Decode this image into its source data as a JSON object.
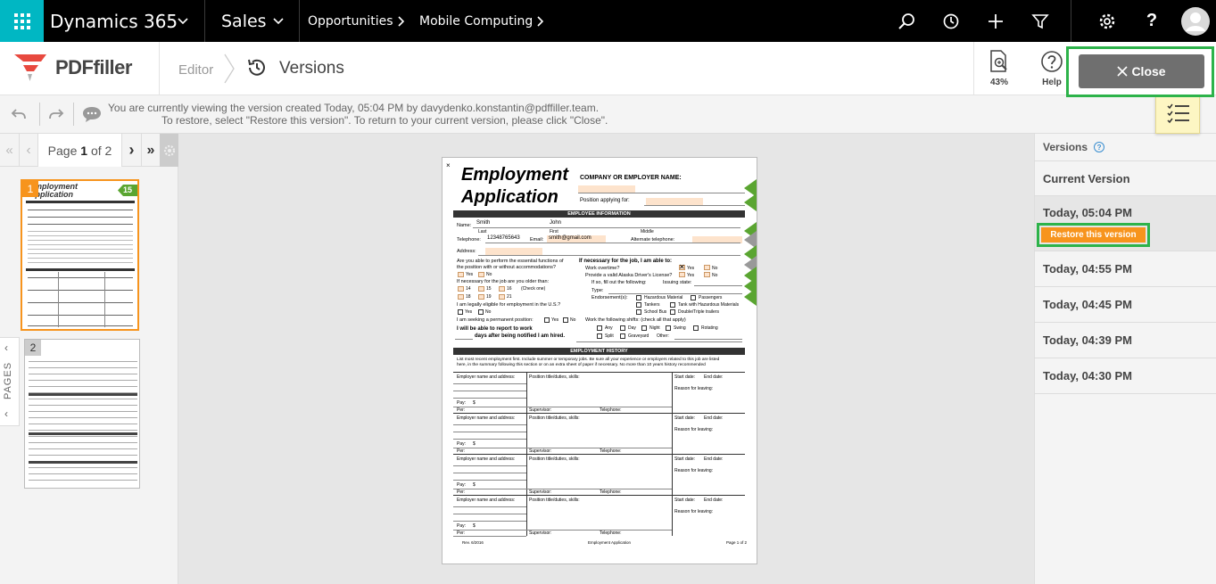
{
  "topbar": {
    "app_name": "Dynamics 365",
    "module": "Sales",
    "breadcrumb": [
      "Opportunities",
      "Mobile Computing"
    ]
  },
  "pdfbar": {
    "logo_text": "PDFfiller",
    "editor_label": "Editor",
    "versions_title": "Versions",
    "zoom": "43%",
    "help_label": "Help",
    "close_label": "Close"
  },
  "message": {
    "line1": "You are currently viewing the version created Today, 05:04 PM by davydenko.konstantin@pdffiller.team.",
    "line2": "To restore, select \"Restore this version\". To return to your current version, please click \"Close\"."
  },
  "pager": {
    "prefix": "Page",
    "current": "1",
    "of": "of 2"
  },
  "thumbnails": [
    {
      "number": "1",
      "badge": "15"
    },
    {
      "number": "2"
    }
  ],
  "pages_tab": "PAGES",
  "versions_panel": {
    "title": "Versions",
    "current": "Current Version",
    "selected": "Today, 05:04 PM",
    "restore_label": "Restore this version",
    "items": [
      "Today, 04:55 PM",
      "Today, 04:45 PM",
      "Today, 04:39 PM",
      "Today, 04:30 PM"
    ]
  },
  "doc": {
    "title1": "Employment",
    "title2": "Application",
    "company_label": "COMPANY OR EMPLOYER NAME:",
    "position_label": "Position applying for:",
    "sec_info": "EMPLOYEE INFORMATION",
    "name_label": "Name:",
    "last_name": "Smith",
    "first_name": "John",
    "last_label": "Last",
    "first_label": "First",
    "middle_label": "Middle",
    "telephone_label": "Telephone:",
    "telephone": "12348765643",
    "email_label": "Email:",
    "email": "smith@gmail.com",
    "alt_phone_label": "Alternate telephone:",
    "address_label": "Address:",
    "q_able1": "Are you able to perform the essential functions of",
    "q_able2": "the position with or without accommodations?",
    "yes": "Yes",
    "no": "No",
    "q_age": "If necessary for the job are you older than:",
    "ages": [
      "14",
      "15",
      "16",
      "18",
      "19",
      "21"
    ],
    "check_one": "(Check one)",
    "q_legal": "I am legally eligible for employment in the U.S.?",
    "q_perm": "I am seeking a permanent position:",
    "report1": "I will be able to report to work",
    "report2": "days after being notified I am hired.",
    "if_nec": "If necessary for the job, I am able to:",
    "work_ot": "Work overtime?",
    "drivers": "Provide a valid Alaska Driver's License?",
    "if_so": "If so, fill out the following:",
    "issuing": "Issuing state:",
    "type": "Type:",
    "endorse": "Endorsement(s):",
    "endorse_items": [
      "Hazardous Material",
      "Passengers",
      "Tankers",
      "Tank with Hazardous Materials",
      "School Bus",
      "Double/Triple trailers"
    ],
    "shifts_q": "Work the following shifts: (check all that apply)",
    "shifts": [
      "Any",
      "Day",
      "Night",
      "Swing",
      "Rotating",
      "Split",
      "Graveyard",
      "Other:"
    ],
    "sec_history": "EMPLOYMENT HISTORY",
    "history_text1": "List most recent employment first. Include summer or temporary jobs. Be sure all your experience or employers related to this job are listed",
    "history_text2": "here, in the summary following this section or on an extra sheet of paper if necessary. No more than 10 years history recommended",
    "emp_label": "Employer name and address:",
    "pos_label": "Position title/duties, skills:",
    "start_label": "Start date:",
    "end_label": "End date:",
    "reason_label": "Reason for leaving:",
    "pay_label": "Pay:",
    "dollar": "$",
    "per_label": "Per:",
    "supervisor_label": "Supervisor:",
    "tel_label": "Telephone:",
    "footer_left": "Rev. 6/2016",
    "footer_center": "Employment Application",
    "footer_right": "Page 1 of 2"
  }
}
